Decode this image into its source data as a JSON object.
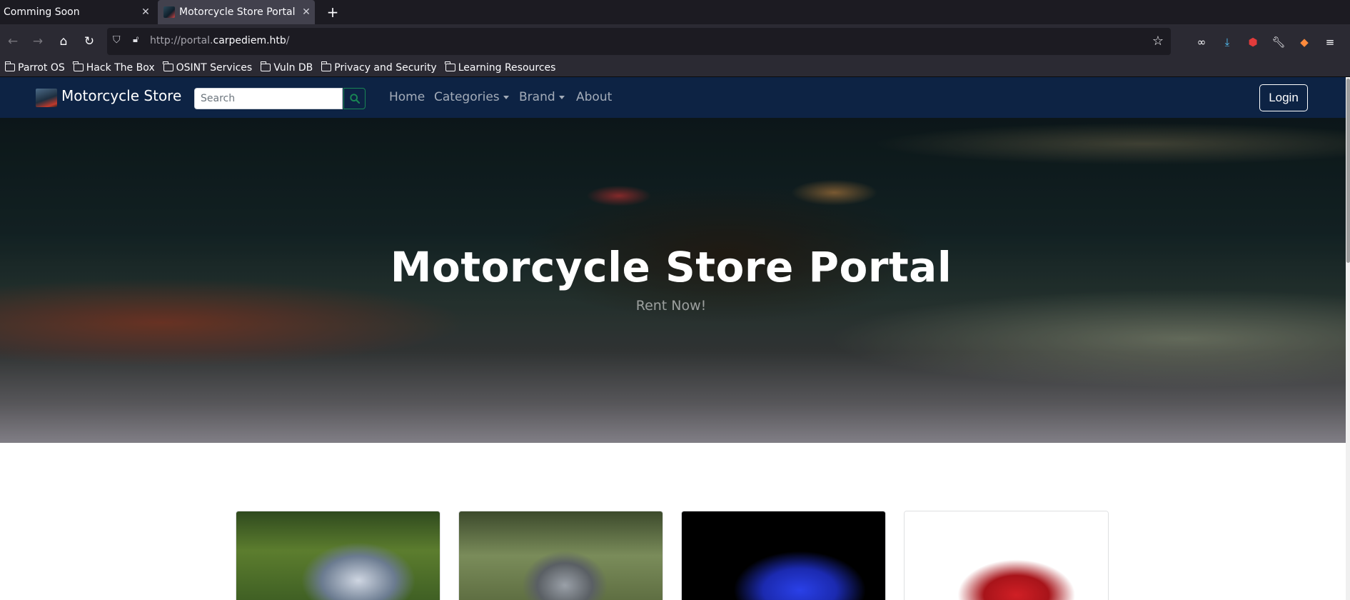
{
  "browser": {
    "tabs": [
      {
        "title": "Comming Soon",
        "active": false
      },
      {
        "title": "Motorcycle Store Portal",
        "active": true
      }
    ],
    "url_prefix": "http://portal.",
    "url_domain": "carpediem.htb",
    "url_suffix": "/",
    "bookmarks": [
      "Parrot OS",
      "Hack The Box",
      "OSINT Services",
      "Vuln DB",
      "Privacy and Security",
      "Learning Resources"
    ]
  },
  "site": {
    "brand": "Motorcycle Store",
    "search_placeholder": "Search",
    "nav": {
      "home": "Home",
      "categories": "Categories",
      "brand": "Brand",
      "about": "About"
    },
    "login_label": "Login",
    "search_accent": "#198754",
    "nav_bg": "#0d2344"
  },
  "hero": {
    "title": "Motorcycle Store Portal",
    "subtitle": "Rent Now!"
  },
  "cards": [
    {
      "image": "motorcycle-adventure-blue-white"
    },
    {
      "image": "motorcycle-scooter-gray"
    },
    {
      "image": "motorcycle-sport-blue"
    },
    {
      "image": "motorcycle-sport-red"
    }
  ]
}
